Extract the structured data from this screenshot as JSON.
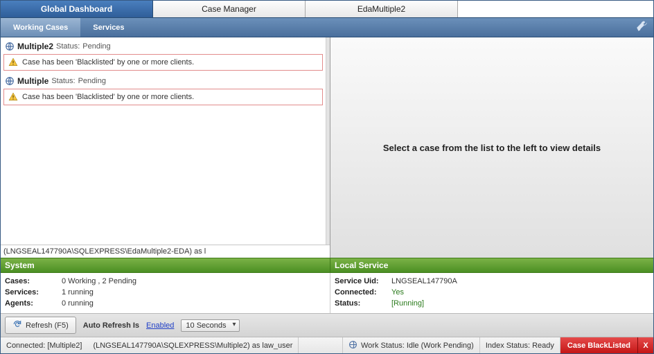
{
  "top_tabs": {
    "global_dashboard": "Global Dashboard",
    "case_manager": "Case Manager",
    "eda_multiple2": "EdaMultiple2"
  },
  "sub_tabs": {
    "working_cases": "Working Cases",
    "services": "Services"
  },
  "cases": [
    {
      "name": "Multiple2",
      "status_label": "Status:",
      "status_value": "Pending",
      "alert": "Case has been 'Blacklisted' by one or more clients."
    },
    {
      "name": "Multiple",
      "status_label": "Status:",
      "status_value": "Pending",
      "alert": "Case has been 'Blacklisted' by one or more clients."
    }
  ],
  "left_conn_footer": "(LNGSEAL147790A\\SQLEXPRESS\\EdaMultiple2-EDA) as l",
  "right_placeholder": "Select a case from the list to the left to view details",
  "green": {
    "system": "System",
    "local_service": "Local Service"
  },
  "system_stats": {
    "cases_label": "Cases:",
    "cases_value": "0 Working ,  2 Pending",
    "services_label": "Services:",
    "services_value": "1 running",
    "agents_label": "Agents:",
    "agents_value": "0 running"
  },
  "local_service": {
    "uid_label": "Service Uid:",
    "uid_value": "LNGSEAL147790A",
    "connected_label": "Connected:",
    "connected_value": "Yes",
    "status_label": "Status:",
    "status_value": "[Running]"
  },
  "refresh_bar": {
    "refresh_btn": "Refresh (F5)",
    "auto_refresh_label": "Auto Refresh Is",
    "enabled": "Enabled",
    "interval": "10 Seconds"
  },
  "status_bar": {
    "connected": "Connected: [Multiple2]",
    "conn_path": "(LNGSEAL147790A\\SQLEXPRESS\\Multiple2) as law_user",
    "work_status": "Work Status: Idle (Work Pending)",
    "index_status": "Index Status: Ready",
    "blacklist": "Case BlackListed",
    "x": "X"
  }
}
